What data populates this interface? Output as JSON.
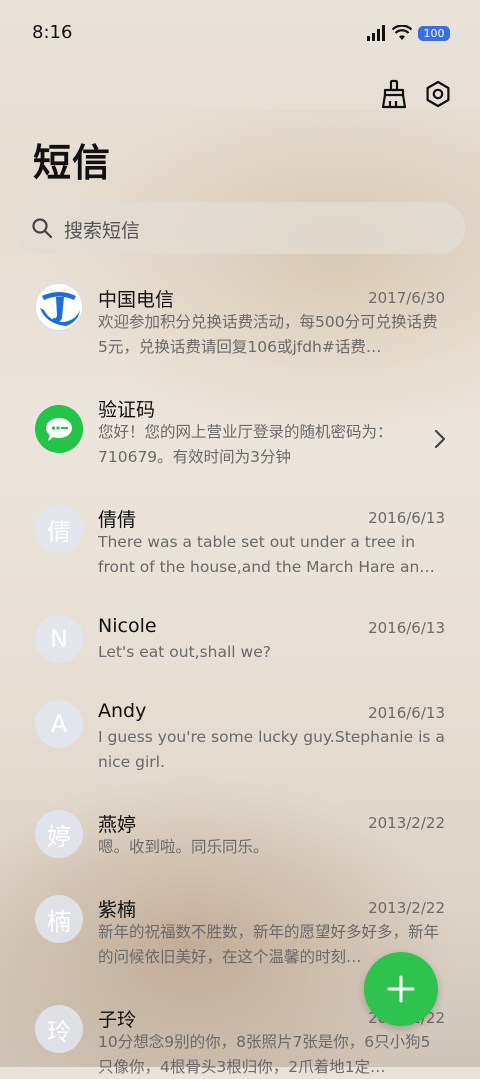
{
  "status_bar": {
    "time": "8:16",
    "battery": "100"
  },
  "toolbar": {
    "clean_icon": "broom-icon",
    "settings_icon": "gear-icon"
  },
  "page_title": "短信",
  "search": {
    "placeholder": "搜索短信",
    "icon": "search-icon"
  },
  "conversations": [
    {
      "name": "中国电信",
      "date": "2017/6/30",
      "preview": "欢迎参加积分兑换话费活动，每500分可兑换话费5元，兑换话费请回复106或jfdh#话费…",
      "avatar": "china-telecom-logo"
    },
    {
      "name": "验证码",
      "date": "",
      "preview": "您好！您的网上营业厅登录的随机密码为：710679。有效时间为3分钟",
      "avatar": "message-bubble-icon"
    },
    {
      "name": "倩倩",
      "date": "2016/6/13",
      "preview": "There was a table set out under a tree in front of the house,and the March Hare an…",
      "avatar_text": "倩"
    },
    {
      "name": "Nicole",
      "date": "2016/6/13",
      "preview": "Let's eat out,shall we?",
      "avatar_text": "N"
    },
    {
      "name": "Andy",
      "date": "2016/6/13",
      "preview": "I guess you're some lucky guy.Stephanie is a nice girl.",
      "avatar_text": "A"
    },
    {
      "name": "燕婷",
      "date": "2013/2/22",
      "preview": "嗯。收到啦。同乐同乐。",
      "avatar_text": "婷"
    },
    {
      "name": "紫楠",
      "date": "2013/2/22",
      "preview": "新年的祝福数不胜数，新年的愿望好多好多，新年的问候依旧美好，在这个温馨的时刻…",
      "avatar_text": "楠"
    },
    {
      "name": "子玲",
      "date": "2013/2/22",
      "preview": "10分想念9别的你，8张照片7张是你，6只小狗5只像你，4根骨头3根归你，2爪着地1定…",
      "avatar_text": "玲"
    }
  ],
  "fab": {
    "icon": "plus-icon"
  },
  "colors": {
    "accent_green": "#2ec34e",
    "telecom_blue": "#1b6fd6",
    "battery_blue": "#3a6fe0"
  }
}
